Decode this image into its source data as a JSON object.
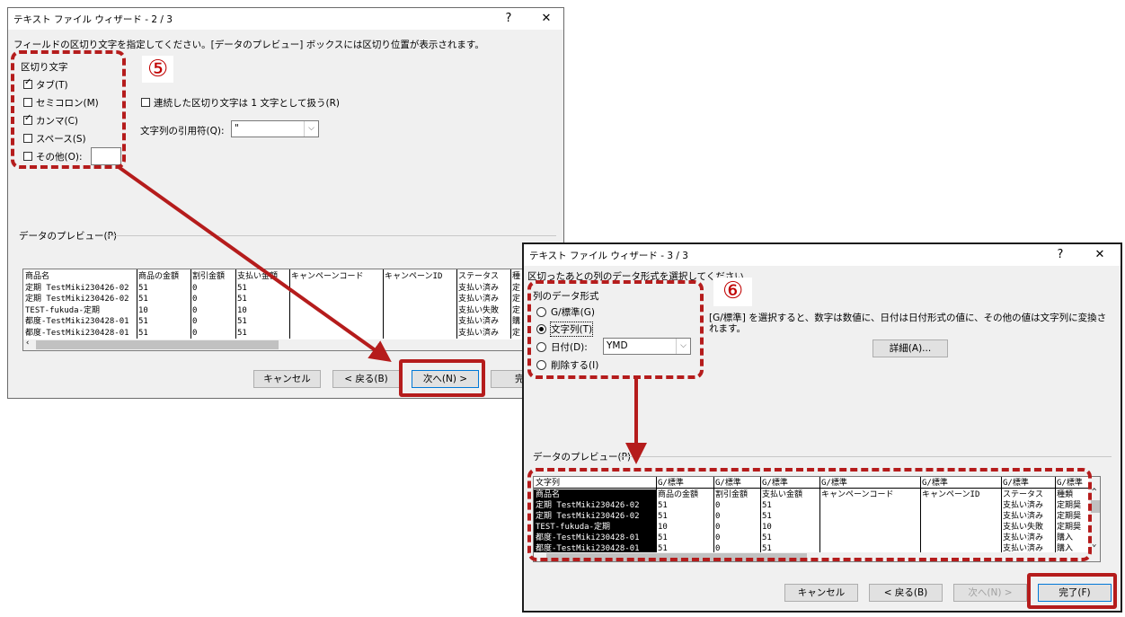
{
  "dialog1": {
    "title": "テキスト ファイル ウィザード - 2 / 3",
    "help": "?",
    "close": "✕",
    "instruction": "フィールドの区切り文字を指定してください。[データのプレビュー] ボックスには区切り位置が表示されます。",
    "delimiters_label": "区切り文字",
    "delimiters": [
      {
        "label": "タブ(T)",
        "checked": true
      },
      {
        "label": "セミコロン(M)",
        "checked": false
      },
      {
        "label": "カンマ(C)",
        "checked": true
      },
      {
        "label": "スペース(S)",
        "checked": false
      },
      {
        "label": "その他(O):",
        "checked": false
      }
    ],
    "consecutive_label": "連続した区切り文字は 1 文字として扱う(R)",
    "qualifier_label": "文字列の引用符(Q):",
    "qualifier_value": "\"",
    "preview_label": "データのプレビュー(P)",
    "preview_columns": [
      "商品名",
      "商品の金額",
      "割引金額",
      "支払い金額",
      "キャンペーンコード",
      "キャンペーンID",
      "ステータス",
      "種"
    ],
    "preview_rows": [
      [
        "商品名",
        "商品の金額",
        "割引金額",
        "支払い金額",
        "キャンペーンコード",
        "キャンペーンID",
        "ステータス",
        "種"
      ],
      [
        "定期 TestMiki230426-02",
        "51",
        "0",
        "51",
        "",
        "",
        "支払い済み",
        "定"
      ],
      [
        "定期 TestMiki230426-02",
        "51",
        "0",
        "51",
        "",
        "",
        "支払い済み",
        "定"
      ],
      [
        "TEST-fukuda-定期",
        "10",
        "0",
        "10",
        "",
        "",
        "支払い失敗",
        "定"
      ],
      [
        "都度-TestMiki230428-01",
        "51",
        "0",
        "51",
        "",
        "",
        "支払い済み",
        "購"
      ],
      [
        "都度-TestMiki230428-01",
        "51",
        "0",
        "51",
        "",
        "",
        "支払い済み",
        "定"
      ]
    ],
    "cancel": "キャンセル",
    "back": "< 戻る(B)",
    "next": "次へ(N) >",
    "finish": "完了"
  },
  "dialog2": {
    "title": "テキスト ファイル ウィザード - 3 / 3",
    "help": "?",
    "close": "✕",
    "instruction": "区切ったあとの列のデータ形式を選択してください。",
    "format_label": "列のデータ形式",
    "formats": [
      {
        "label": "G/標準(G)",
        "selected": false
      },
      {
        "label": "文字列(T)",
        "selected": true
      },
      {
        "label": "日付(D):",
        "selected": false
      },
      {
        "label": "削除する(I)",
        "selected": false
      }
    ],
    "date_value": "YMD",
    "description": "[G/標準] を選択すると、数字は数値に、日付は日付形式の値に、その他の値は文字列に変換されます。",
    "advanced": "詳細(A)...",
    "preview_label": "データのプレビュー(P)",
    "preview_headers": [
      "文字列",
      "G/標準",
      "G/標準",
      "G/標準",
      "G/標準",
      "G/標準",
      "G/標準",
      "G/標準"
    ],
    "preview_rows": [
      [
        "商品名",
        "商品の金額",
        "割引金額",
        "支払い金額",
        "キャンペーンコード",
        "キャンペーンID",
        "ステータス",
        "種類"
      ],
      [
        "定期 TestMiki230426-02",
        "51",
        "0",
        "51",
        "",
        "",
        "支払い済み",
        "定期奨"
      ],
      [
        "定期 TestMiki230426-02",
        "51",
        "0",
        "51",
        "",
        "",
        "支払い済み",
        "定期奨"
      ],
      [
        "TEST-fukuda-定期",
        "10",
        "0",
        "10",
        "",
        "",
        "支払い失敗",
        "定期奨"
      ],
      [
        "都度-TestMiki230428-01",
        "51",
        "0",
        "51",
        "",
        "",
        "支払い済み",
        "購入"
      ],
      [
        "都度-TestMiki230428-01",
        "51",
        "0",
        "51",
        "",
        "",
        "支払い済み",
        "購入"
      ]
    ],
    "cancel": "キャンセル",
    "back": "< 戻る(B)",
    "next": "次へ(N) >",
    "finish": "完了(F)"
  },
  "annotations": {
    "step5": "⑤",
    "step6": "⑥",
    "color": "#b51c1c"
  }
}
